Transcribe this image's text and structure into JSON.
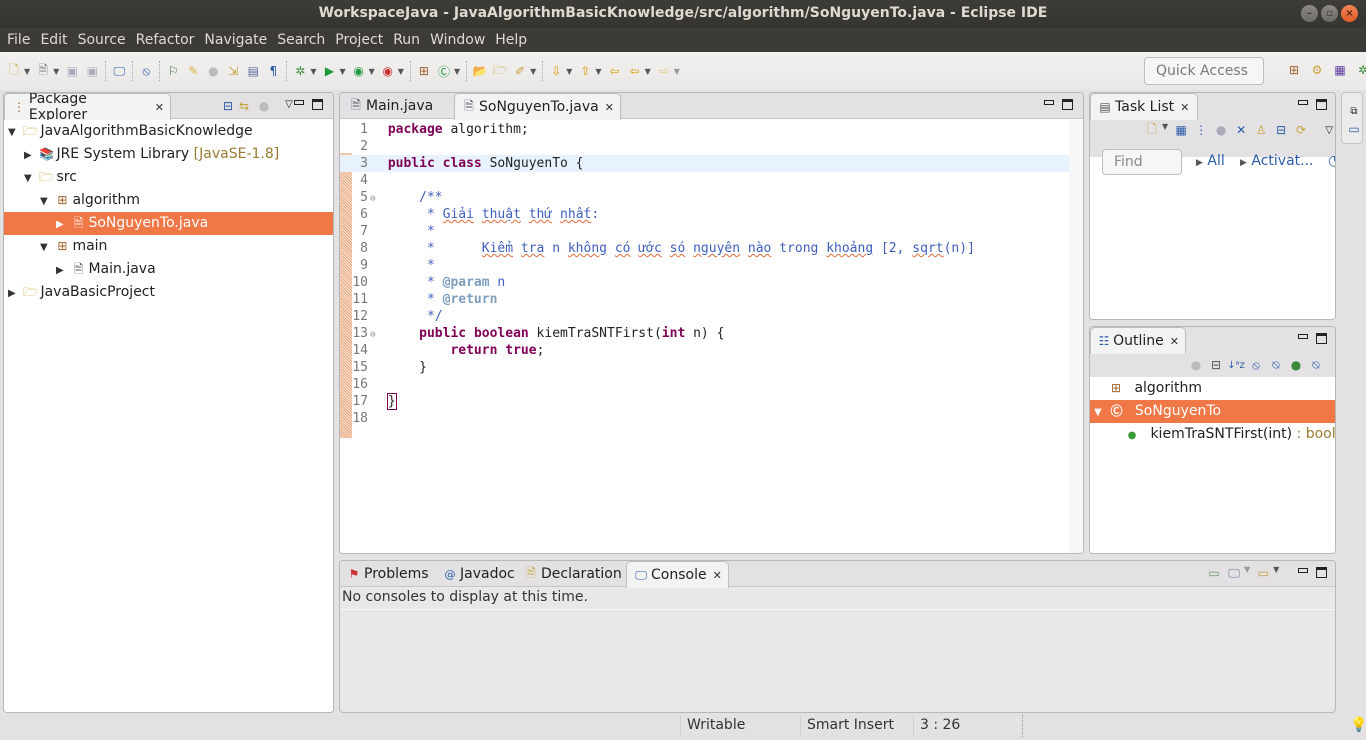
{
  "window": {
    "title": "WorkspaceJava - JavaAlgorithmBasicKnowledge/src/algorithm/SoNguyenTo.java - Eclipse IDE",
    "controls": [
      "–",
      "▢",
      "✕"
    ]
  },
  "menu": [
    "File",
    "Edit",
    "Source",
    "Refactor",
    "Navigate",
    "Search",
    "Project",
    "Run",
    "Window",
    "Help"
  ],
  "toolbar": {
    "quick_access_placeholder": "Quick Access"
  },
  "package_explorer": {
    "title": "Package Explorer",
    "tree": [
      {
        "label": "JavaAlgorithmBasicKnowledge",
        "depth": 0,
        "expanded": true,
        "icon": "project-icon"
      },
      {
        "label": "JRE System Library",
        "decoration": "[JavaSE-1.8]",
        "depth": 1,
        "expanded": false,
        "icon": "library-icon"
      },
      {
        "label": "src",
        "depth": 1,
        "expanded": true,
        "icon": "source-folder-icon"
      },
      {
        "label": "algorithm",
        "depth": 2,
        "expanded": true,
        "icon": "package-icon"
      },
      {
        "label": "SoNguyenTo.java",
        "depth": 3,
        "expanded": false,
        "icon": "java-file-icon",
        "selected": true
      },
      {
        "label": "main",
        "depth": 2,
        "expanded": true,
        "icon": "package-icon"
      },
      {
        "label": "Main.java",
        "depth": 3,
        "expanded": false,
        "icon": "java-file-icon"
      },
      {
        "label": "JavaBasicProject",
        "depth": 0,
        "expanded": false,
        "icon": "project-icon"
      }
    ]
  },
  "editor": {
    "tabs": [
      {
        "label": "Main.java",
        "active": false
      },
      {
        "label": "SoNguyenTo.java",
        "active": true
      }
    ],
    "current_line": 3,
    "lines": [
      {
        "n": "1",
        "text": "package algorithm;"
      },
      {
        "n": "2",
        "text": ""
      },
      {
        "n": "3",
        "text": "public class SoNguyenTo {"
      },
      {
        "n": "4",
        "text": ""
      },
      {
        "n": "5",
        "text": "    /**"
      },
      {
        "n": "6",
        "text": "     * Giải thuật thứ nhất:"
      },
      {
        "n": "7",
        "text": "     *"
      },
      {
        "n": "8",
        "text": "     *      Kiểm tra n không có ước só nguyên nào trong khoảng [2, sqrt(n)]"
      },
      {
        "n": "9",
        "text": "     *"
      },
      {
        "n": "10",
        "text": "     * @param n"
      },
      {
        "n": "11",
        "text": "     * @return"
      },
      {
        "n": "12",
        "text": "     */"
      },
      {
        "n": "13",
        "text": "    public boolean kiemTraSNTFirst(int n) {"
      },
      {
        "n": "14",
        "text": "        return true;"
      },
      {
        "n": "15",
        "text": "    }"
      },
      {
        "n": "16",
        "text": ""
      },
      {
        "n": "17",
        "text": "}"
      },
      {
        "n": "18",
        "text": ""
      }
    ]
  },
  "task_list": {
    "title": "Task List",
    "find_placeholder": "Find",
    "links": [
      "All",
      "Activat..."
    ]
  },
  "outline": {
    "title": "Outline",
    "items": [
      {
        "label": "algorithm",
        "icon": "package-icon"
      },
      {
        "label": "SoNguyenTo",
        "icon": "class-icon",
        "selected": true
      },
      {
        "label": "kiemTraSNTFirst(int)",
        "type": " : boole",
        "icon": "public-method-icon"
      }
    ]
  },
  "bottom_panel": {
    "tabs": [
      {
        "label": "Problems"
      },
      {
        "label": "Javadoc"
      },
      {
        "label": "Declaration"
      },
      {
        "label": "Console",
        "active": true
      }
    ],
    "console_message": "No consoles to display at this time."
  },
  "status": {
    "writable": "Writable",
    "insert_mode": "Smart Insert",
    "position": "3 : 26"
  },
  "colors": {
    "selection": "#f07746",
    "keyword": "#7f0055",
    "javadoc": "#3f5fbf",
    "current_line": "#e8f2fe"
  }
}
